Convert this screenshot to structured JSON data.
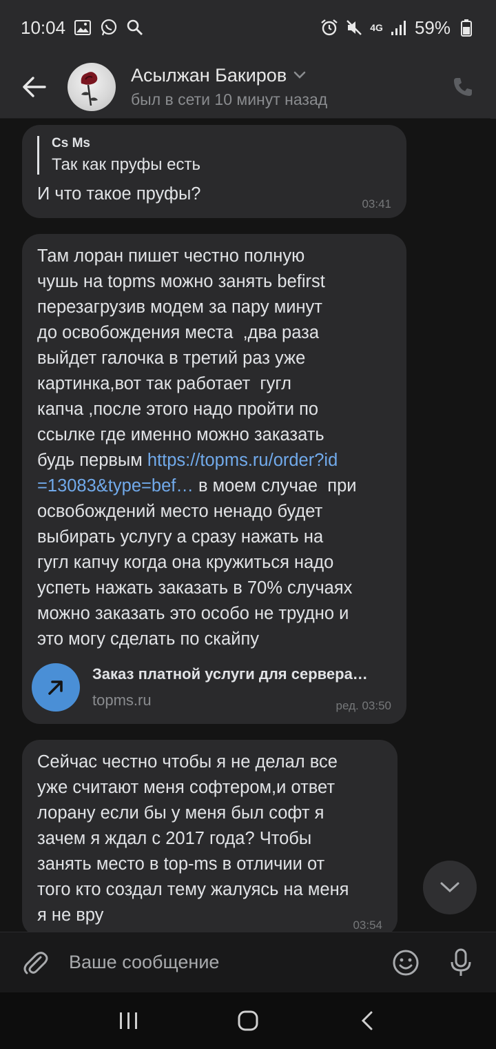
{
  "status_bar": {
    "time": "10:04",
    "network": "4G",
    "battery": "59%"
  },
  "header": {
    "name": "Асылжан Бакиров",
    "status": "был в сети 10 минут назад"
  },
  "messages": [
    {
      "reply_author": "Cs Ms",
      "reply_text": "Так как пруфы есть",
      "text": "И что такое пруфы?",
      "time": "03:41"
    },
    {
      "text_before_link": "Там лоран пишет честно полную\nчушь на topms можно занять befirst\nперезагрузив модем за пару минут\nдо освобождения места  ,два раза\nвыйдет галочка в третий раз уже\nкартинка,вот так работает  гугл\nкапча ,после этого надо пройти по\nссылке где именно можно заказать\nбудь первым ",
      "link": "https://topms.ru/order?id\n=13083&type=bef…",
      "text_after_link": " в моем случае  при\nосвобождений место ненадо будет\nвыбирать услугу а сразу нажать на\nгугл капчу когда она кружиться надо\nуспеть нажать заказать в 70% случаях\nможно заказать это особо не трудно и\nэто могу сделать по скайпу",
      "snippet_title": "Заказ платной услуги для сервера…",
      "snippet_domain": "topms.ru",
      "time": "ред. 03:50"
    },
    {
      "text": "Сейчас честно чтобы я не делал все\nуже считают меня софтером,и ответ\nлорану если бы у меня был софт я\nзачем я ждал с 2017 года? Чтобы\nзанять место в top-ms в отличии от\nтого кто создал тему жалуясь на меня\nя не вру",
      "time": "03:54"
    }
  ],
  "composer": {
    "placeholder": "Ваше сообщение"
  },
  "colors": {
    "background": "#141414",
    "bubble": "#2a2a2c",
    "link": "#71aaeb",
    "accent": "#4a8fd6"
  },
  "icons": [
    "back-arrow-icon",
    "phone-icon",
    "chevron-down-icon",
    "arrow-up-right-icon",
    "paperclip-icon",
    "emoji-icon",
    "microphone-icon"
  ]
}
